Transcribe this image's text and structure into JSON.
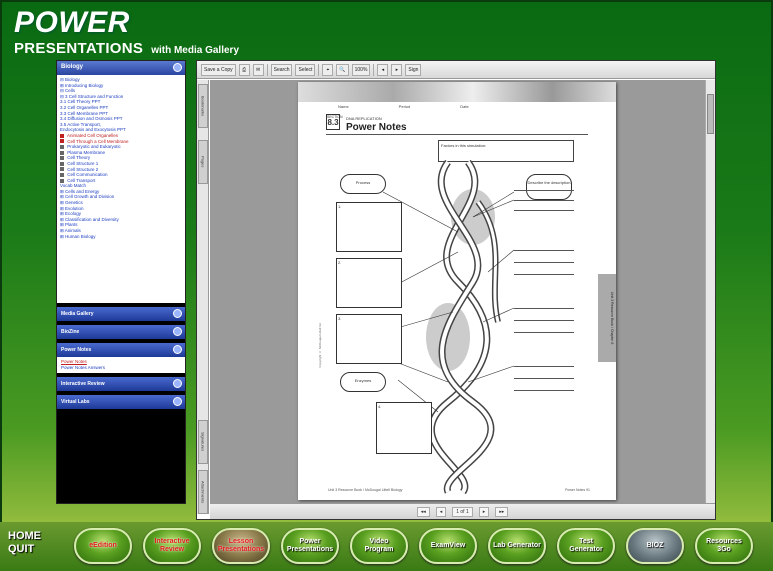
{
  "app": {
    "logo_power": "POWER",
    "logo_presentations": "PRESENTATIONS",
    "logo_media": "with Media Gallery"
  },
  "nav": {
    "top_header": "Biology",
    "tree": [
      {
        "text": "⊟ Biology",
        "style": "norm"
      },
      {
        "text": "  ⊞ Introducing Biology",
        "style": "norm"
      },
      {
        "text": "  ⊟ Cells",
        "style": "norm"
      },
      {
        "text": "    ⊟ 3 Cell Structure and Function",
        "style": "norm"
      },
      {
        "text": "        3.1 Cell Theory PPT",
        "style": "norm"
      },
      {
        "text": "        3.2 Cell Organelles PPT",
        "style": "norm"
      },
      {
        "text": "        3.3 Cell Membrane PPT",
        "style": "norm"
      },
      {
        "text": "        3.4 Diffusion and Osmosis PPT",
        "style": "norm"
      },
      {
        "text": "        3.5 Active Transport,",
        "style": "norm"
      },
      {
        "text": "          Endocytosis and Exocytosis PPT",
        "style": "norm"
      },
      {
        "text": "        Animated Cell Organelles",
        "style": "red",
        "icon": "r"
      },
      {
        "text": "        Cell Through a Cell Membrane",
        "style": "red",
        "icon": "r"
      },
      {
        "text": "        Prokaryotic and Eukaryotic",
        "style": "norm",
        "icon": "g"
      },
      {
        "text": "        Plasma Membrane",
        "style": "norm",
        "icon": "g"
      },
      {
        "text": "        Cell Theory",
        "style": "norm",
        "icon": "g"
      },
      {
        "text": "        Cell Structure 1",
        "style": "norm",
        "icon": "g"
      },
      {
        "text": "        Cell Structure 2",
        "style": "norm",
        "icon": "g"
      },
      {
        "text": "        Cell Communication",
        "style": "norm",
        "icon": "g"
      },
      {
        "text": "        Cell Transport",
        "style": "norm",
        "icon": "g"
      },
      {
        "text": "        Vocab Match",
        "style": "norm"
      },
      {
        "text": "    ⊞ Cells and Energy",
        "style": "norm"
      },
      {
        "text": "    ⊞ Cell Growth and Division",
        "style": "norm"
      },
      {
        "text": "  ⊞ Genetics",
        "style": "norm"
      },
      {
        "text": "  ⊞ Evolution",
        "style": "norm"
      },
      {
        "text": "  ⊞ Ecology",
        "style": "norm"
      },
      {
        "text": "  ⊞ Classification and Diversity",
        "style": "norm"
      },
      {
        "text": "  ⊞ Plants",
        "style": "norm"
      },
      {
        "text": "  ⊞ Animals",
        "style": "norm"
      },
      {
        "text": "  ⊞ Human Biology",
        "style": "norm"
      }
    ],
    "sections": [
      {
        "label": "Media Gallery"
      },
      {
        "label": "BioZine"
      },
      {
        "label": "Power Notes",
        "subitems": [
          {
            "text": "Power Notes",
            "selected": true
          },
          {
            "text": "Power Notes Answers",
            "selected": false
          }
        ]
      },
      {
        "label": "Interactive Review"
      },
      {
        "label": "Virtual Labs"
      }
    ]
  },
  "viewer": {
    "toolbar": [
      "Save a Copy",
      "⎙",
      "✉",
      "Search",
      "Select",
      "⌖",
      "🔍",
      "100%",
      "◂",
      "▸",
      "Sign"
    ],
    "side_tabs": [
      "Bookmarks",
      "Pages",
      "Signatures",
      "Attachments"
    ],
    "status": [
      "◂◂",
      "◂",
      "1 of 1",
      "▸",
      "▸▸"
    ]
  },
  "page": {
    "fields": [
      "Name",
      "Period",
      "Date"
    ],
    "section_label": "SECTION",
    "section_num": "8.3",
    "subtitle": "DNA REPLICATION",
    "title": "Power Notes",
    "hilite_caption": "Factors in this simulation:",
    "oval_left": "Process",
    "oval_right": "Describe the description",
    "oval_bottom": "Enzymes",
    "box_labels": [
      "1.",
      "2.",
      "3.",
      "4."
    ],
    "side_label": "Unit 3 Resource Book / Chapter 8",
    "copyright": "Copyright © McDougal Littell Inc.",
    "foot_left": "Unit 3 Resource Book / McDougal Littell Biology",
    "foot_right": "Power Notes  91"
  },
  "bottom": {
    "home": "HOME",
    "quit": "QUIT",
    "buttons": [
      {
        "label": "eEdition",
        "style": "red"
      },
      {
        "label": "Interactive Review",
        "style": "red"
      },
      {
        "label": "Lesson Presentations",
        "style": "red sel"
      },
      {
        "label": "Power Presentations",
        "style": ""
      },
      {
        "label": "Video Program",
        "style": ""
      },
      {
        "label": "ExamView",
        "style": ""
      },
      {
        "label": "Lab Generator",
        "style": ""
      },
      {
        "label": "Test Generator",
        "style": ""
      },
      {
        "label": "BIOZ",
        "style": "gray"
      },
      {
        "label": "Resources 3Go",
        "style": ""
      }
    ]
  }
}
